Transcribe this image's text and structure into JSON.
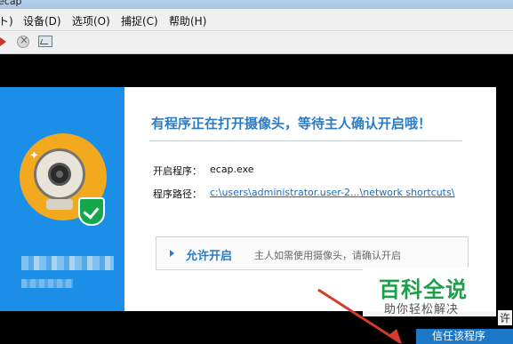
{
  "window": {
    "title_fragment": "ecap"
  },
  "menu": {
    "items": [
      "ト)",
      "设备(D)",
      "选项(O)",
      "捕捉(C)",
      "帮助(H)"
    ]
  },
  "toolbar": {
    "icons": [
      "play-icon",
      "stop-icon",
      "snapshot-icon"
    ]
  },
  "dialog": {
    "headline": "有程序正在打开摄像头，等待主人确认开启哦！",
    "open_program_label": "开启程序：",
    "open_program_value": "ecap.exe",
    "program_path_label": "程序路径：",
    "program_path_value": "c:\\users\\administrator.user-2...\\network shortcuts\\",
    "allow_button": "允许开启",
    "allow_hint": "主人如需使用摄像头，请确认开启"
  },
  "watermark": {
    "title": "百科全说",
    "subtitle": "助你轻松解决"
  },
  "right_fragment": "许",
  "trust_button": "信任该程序",
  "colors": {
    "brand_blue": "#1b8ee8",
    "accent_text": "#2b7cc4",
    "watermark_green": "#1f9e4a",
    "arrow_red": "#d23b2e"
  }
}
